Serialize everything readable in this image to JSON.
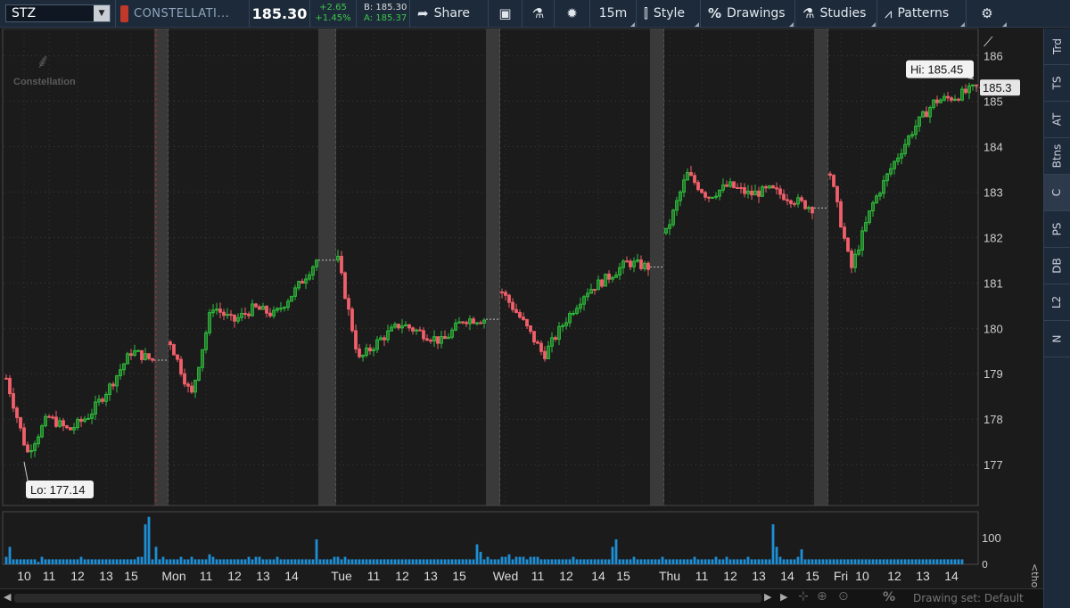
{
  "toolbar": {
    "symbol": "STZ",
    "company": "CONSTELLATI...",
    "last": "185.30",
    "change": "+2.65",
    "change_pct": "+1.45%",
    "bid": "B: 185.30",
    "ask": "A: 185.37",
    "share": "Share",
    "timeframe": "15m",
    "style": "Style",
    "drawings": "Drawings",
    "studies": "Studies",
    "patterns": "Patterns"
  },
  "colors": {
    "up": "#2fbf3c",
    "down": "#f0606a",
    "volume": "#1e8fd6",
    "bg": "#1b1b1b",
    "toolbar": "#1d2a3a"
  },
  "chart_data": {
    "type": "candlestick",
    "title": "",
    "ylabel": "",
    "ylim": [
      176.1,
      186.6
    ],
    "yticks": [
      177,
      178,
      179,
      180,
      181,
      182,
      183,
      184,
      185,
      186
    ],
    "volume_ticks": [
      "100"
    ],
    "volume_label": "<thous...",
    "xlabels": [
      {
        "t": "10",
        "i": 5
      },
      {
        "t": "11",
        "i": 12
      },
      {
        "t": "12",
        "i": 20
      },
      {
        "t": "13",
        "i": 28
      },
      {
        "t": "15",
        "i": 35
      },
      {
        "t": "Mon",
        "i": 47
      },
      {
        "t": "11",
        "i": 56
      },
      {
        "t": "12",
        "i": 64
      },
      {
        "t": "13",
        "i": 72
      },
      {
        "t": "14",
        "i": 80
      },
      {
        "t": "Tue",
        "i": 94
      },
      {
        "t": "11",
        "i": 103
      },
      {
        "t": "12",
        "i": 111
      },
      {
        "t": "13",
        "i": 119
      },
      {
        "t": "15",
        "i": 127
      },
      {
        "t": "Wed",
        "i": 140
      },
      {
        "t": "11",
        "i": 149
      },
      {
        "t": "12",
        "i": 157
      },
      {
        "t": "14",
        "i": 166
      },
      {
        "t": "15",
        "i": 173
      },
      {
        "t": "Thu",
        "i": 186
      },
      {
        "t": "11",
        "i": 195
      },
      {
        "t": "12",
        "i": 203
      },
      {
        "t": "13",
        "i": 211
      },
      {
        "t": "14",
        "i": 219
      },
      {
        "t": "15",
        "i": 226
      },
      {
        "t": "Fri",
        "i": 234
      },
      {
        "t": "10",
        "i": 240
      },
      {
        "t": "12",
        "i": 249
      },
      {
        "t": "13",
        "i": 257
      },
      {
        "t": "14",
        "i": 265
      }
    ],
    "sessions": [
      {
        "s": 0,
        "e": 41,
        "close": 179.3
      },
      {
        "s": 46,
        "e": 87,
        "close": 181.5
      },
      {
        "s": 93,
        "e": 134,
        "close": 180.2
      },
      {
        "s": 139,
        "e": 180,
        "close": 181.35
      },
      {
        "s": 185,
        "e": 226,
        "close": 182.65
      },
      {
        "s": 231,
        "e": 272,
        "close": null
      }
    ],
    "session_trends": [
      [
        178.9,
        177.25,
        178.05,
        177.75,
        178.1,
        178.75,
        179.5,
        179.3
      ],
      [
        179.7,
        178.5,
        180.5,
        180.15,
        180.45,
        180.3,
        180.85,
        181.5
      ],
      [
        181.5,
        179.3,
        179.75,
        180.1,
        179.9,
        179.7,
        180.2,
        180.2
      ],
      [
        180.8,
        180.15,
        179.4,
        180.15,
        180.8,
        181.1,
        181.45,
        181.35
      ],
      [
        182.1,
        183.4,
        182.9,
        183.15,
        182.95,
        183.05,
        182.85,
        182.65
      ],
      [
        183.4,
        181.3,
        182.7,
        183.6,
        184.4,
        185.0,
        185.1,
        185.3
      ]
    ],
    "volumes": [
      3,
      7,
      2,
      2,
      2,
      2,
      2,
      2,
      2,
      1,
      3,
      2,
      2,
      2,
      2,
      2,
      2,
      2,
      2,
      2,
      2,
      3,
      2,
      2,
      2,
      2,
      2,
      2,
      2,
      2,
      2,
      2,
      2,
      2,
      2,
      2,
      2,
      3,
      3,
      16,
      19,
      2,
      7,
      2,
      3,
      2,
      2,
      2,
      2,
      3,
      2,
      2,
      3,
      2,
      2,
      2,
      2,
      4,
      3,
      2,
      2,
      2,
      2,
      2,
      2,
      2,
      2,
      2,
      3,
      2,
      3,
      3,
      2,
      2,
      2,
      2,
      3,
      2,
      2,
      2,
      2,
      2,
      2,
      2,
      2,
      2,
      2,
      10,
      2,
      2,
      2,
      2,
      3,
      3,
      2,
      3,
      2,
      2,
      2,
      2,
      2,
      2,
      2,
      2,
      2,
      2,
      2,
      2,
      2,
      2,
      2,
      2,
      2,
      2,
      2,
      2,
      2,
      2,
      2,
      2,
      2,
      2,
      2,
      2,
      2,
      2,
      2,
      2,
      2,
      2,
      2,
      2,
      8,
      5,
      2,
      3,
      2,
      2,
      2,
      3,
      3,
      4,
      2,
      3,
      3,
      3,
      2,
      3,
      3,
      3,
      2,
      2,
      2,
      2,
      2,
      2,
      2,
      2,
      2,
      3,
      2,
      2,
      2,
      2,
      2,
      2,
      2,
      2,
      2,
      2,
      7,
      10,
      2,
      2,
      2,
      2,
      3,
      2,
      2,
      2,
      2,
      2,
      2,
      2,
      3,
      2,
      2,
      2,
      2,
      2,
      2,
      2,
      2,
      3,
      2,
      2,
      2,
      2,
      2,
      3,
      2,
      2,
      3,
      2,
      2,
      2,
      2,
      2,
      3,
      2,
      2,
      2,
      2,
      2,
      2,
      16,
      7,
      3,
      2,
      2,
      2,
      2,
      3,
      6,
      2,
      2,
      2,
      2,
      2,
      2,
      2,
      2,
      2,
      2,
      2,
      2,
      2,
      2,
      2,
      2,
      2,
      2,
      2,
      2,
      2,
      2,
      2,
      2,
      2,
      2,
      2,
      2,
      2,
      2,
      2,
      2,
      2,
      2,
      2,
      2,
      2,
      2,
      2,
      2,
      2,
      2,
      2,
      2,
      2
    ],
    "volume_max": 100,
    "hi_label": "Hi: 185.45",
    "lo_label": "Lo: 177.14",
    "price_label": "185.3",
    "hi_price": 185.45,
    "lo_price": 177.14
  },
  "watermark": "Constellation",
  "right_tabs": [
    "Trd",
    "TS",
    "AT",
    "Btns",
    "C",
    "PS",
    "DB",
    "L2",
    "N"
  ],
  "bottom": {
    "drawing_set": "Drawing set: Default",
    "pct": "%"
  }
}
